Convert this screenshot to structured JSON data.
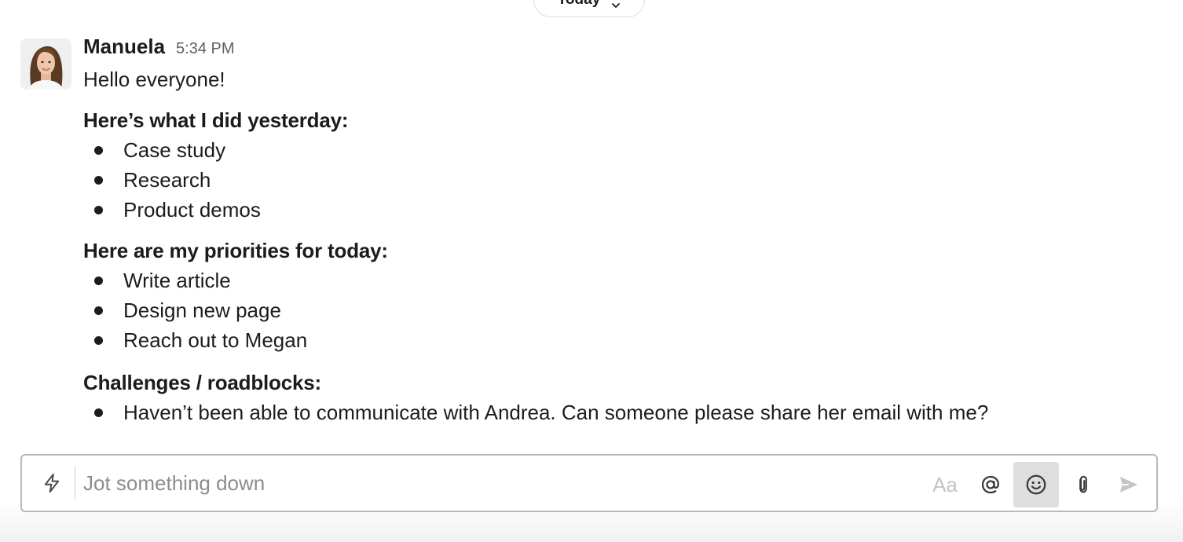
{
  "date_divider": {
    "label": "Today",
    "icon": "chevron-down-icon"
  },
  "message": {
    "author": "Manuela",
    "timestamp": "5:34 PM",
    "greeting": "Hello everyone!",
    "sections": [
      {
        "heading": "Here’s what I did yesterday:",
        "items": [
          "Case study",
          "Research",
          "Product demos"
        ]
      },
      {
        "heading": "Here are my priorities for today:",
        "items": [
          "Write article",
          "Design new page",
          "Reach out to Megan"
        ]
      },
      {
        "heading": "Challenges / roadblocks:",
        "items": [
          "Haven’t been able to communicate with Andrea. Can someone please share her email with me?"
        ]
      }
    ]
  },
  "composer": {
    "placeholder": "Jot something down",
    "value": "",
    "format_label": "Aa",
    "icons": {
      "shortcuts": "lightning-bolt-icon",
      "format": "text-format-icon",
      "mention": "at-sign-icon",
      "emoji": "smiley-icon",
      "attach": "paperclip-icon",
      "send": "send-arrow-icon"
    },
    "colors": {
      "border": "#b9b9b9",
      "emoji_active_bg": "#dedede",
      "disabled_icon": "#c4c4c4"
    }
  }
}
